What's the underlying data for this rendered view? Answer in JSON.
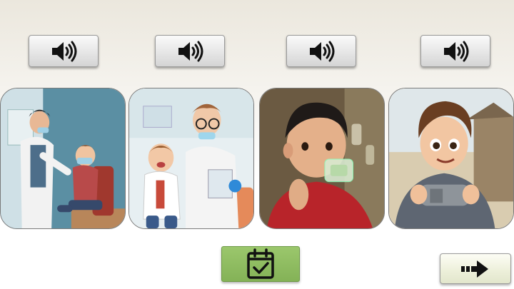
{
  "audio_buttons": [
    {
      "icon": "speaker-icon"
    },
    {
      "icon": "speaker-icon"
    },
    {
      "icon": "speaker-icon"
    },
    {
      "icon": "speaker-icon"
    }
  ],
  "cards": [
    {
      "depicts": "child-with-doctor-examination"
    },
    {
      "depicts": "child-talking-to-doctor"
    },
    {
      "depicts": "child-using-inhaler"
    },
    {
      "depicts": "child-holding-inhaler"
    }
  ],
  "check_button": {
    "icon": "calendar-check-icon",
    "color": "#8fbd62"
  },
  "next_button": {
    "icon": "arrow-right-icon"
  },
  "colors": {
    "background_top": "#ebe7dd",
    "button_face": "#e6e6e6",
    "check_green": "#8fbd62"
  }
}
